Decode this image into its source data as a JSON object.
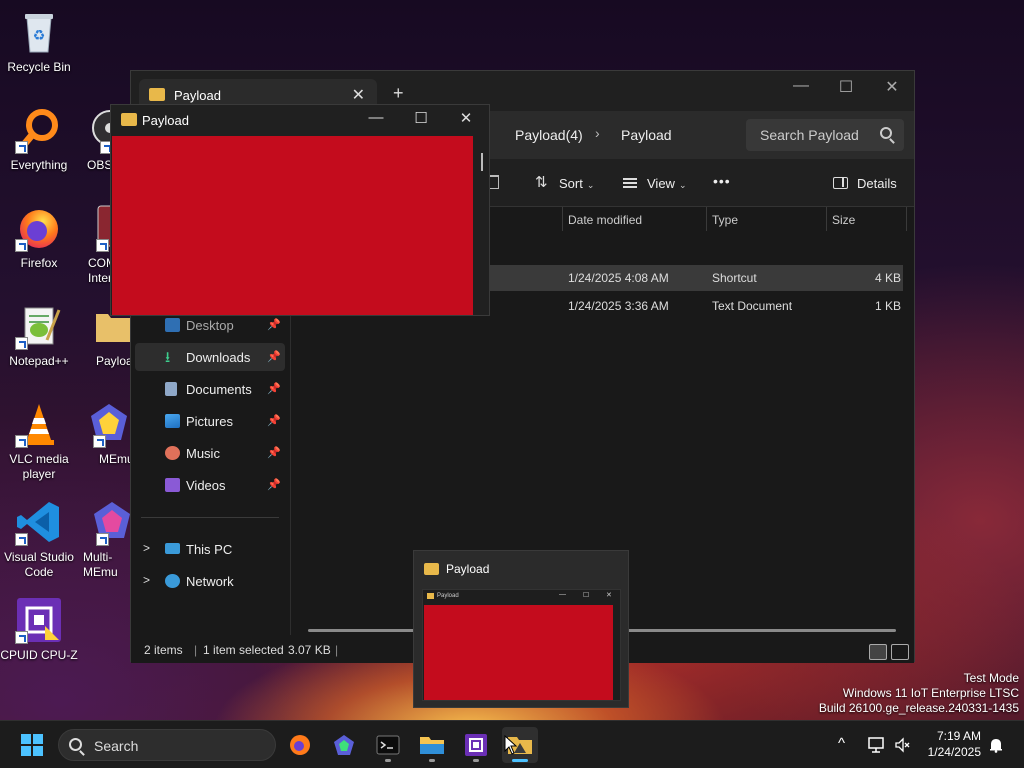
{
  "desktop": {
    "icons": [
      {
        "label": "Recycle Bin"
      },
      {
        "label": "Everything"
      },
      {
        "label": "OBS"
      },
      {
        "label": "Firefox"
      },
      {
        "label": "COM Intern"
      },
      {
        "label": "Notepad++"
      },
      {
        "label": "Payloa"
      },
      {
        "label": "VLC media player"
      },
      {
        "label": "MEmu"
      },
      {
        "label": "Visual Studio Code"
      },
      {
        "label": "Multi-MEmu"
      },
      {
        "label": "CPUID CPU-Z"
      }
    ]
  },
  "explorer": {
    "tab_label": "Payload",
    "tab_close": "✕",
    "new_tab": "+",
    "min": "—",
    "max": "☐",
    "close": "✕",
    "breadcrumb": [
      "Payload(4)",
      "Payload"
    ],
    "breadcrumb_sep": "›",
    "search_placeholder": "Search Payload",
    "toolbar": {
      "sort": "Sort",
      "view": "View",
      "more": "•••",
      "details": "Details",
      "chevron": "⌄"
    },
    "columns": {
      "date": "Date modified",
      "type": "Type",
      "size": "Size"
    },
    "rows": [
      {
        "date": "1/24/2025 4:08 AM",
        "type": "Shortcut",
        "size": "4 KB",
        "selected": true
      },
      {
        "date": "1/24/2025 3:36 AM",
        "type": "Text Document",
        "size": "1 KB",
        "selected": false
      }
    ],
    "nav": {
      "desktop": "Desktop",
      "downloads": "Downloads",
      "documents": "Documents",
      "pictures": "Pictures",
      "music": "Music",
      "videos": "Videos",
      "this_pc": "This PC",
      "network": "Network",
      "pin": "📌",
      "expand": ">"
    },
    "status": {
      "items": "2 items",
      "selected": "1 item selected",
      "size": "3.07 KB"
    }
  },
  "payload_window": {
    "title": "Payload",
    "min": "—",
    "max": "☐",
    "close": "✕",
    "content_color": "#c40c1d"
  },
  "thumbnail": {
    "title": "Payload",
    "mini_title": "Payload",
    "mini_min": "—",
    "mini_max": "☐",
    "mini_close": "✕"
  },
  "watermark": {
    "line1": "Test Mode",
    "line2": "Windows 11 IoT Enterprise LTSC",
    "line3": "Build 26100.ge_release.240331-1435"
  },
  "taskbar": {
    "search_label": "Search",
    "apps": [
      "firefox-icon",
      "memu-icon",
      "terminal-icon",
      "file-explorer-icon",
      "cpuz-icon",
      "payload-folder-icon"
    ],
    "chevron": "^",
    "time": "7:19 AM",
    "date": "1/24/2025"
  },
  "colors": {
    "accent": "#4cc2ff",
    "payload_red": "#c40c1d",
    "folder": "#e8b84a"
  }
}
